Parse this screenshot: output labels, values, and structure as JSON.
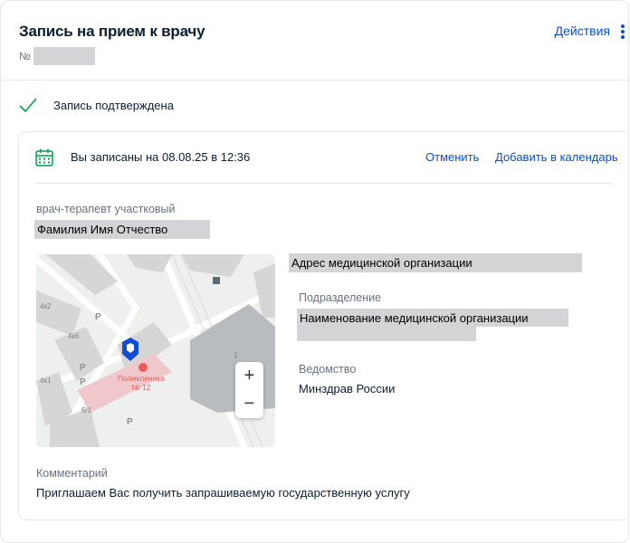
{
  "header": {
    "title": "Запись на прием к врачу",
    "number_prefix": "№",
    "actions_label": "Действия"
  },
  "status": {
    "text": "Запись подтверждена"
  },
  "appointment": {
    "date_text": "Вы записаны на 08.08.25 в 12:36",
    "cancel_label": "Отменить",
    "add_calendar_label": "Добавить в календарь"
  },
  "doctor": {
    "specialty": "врач-терапевт участковый",
    "name": "Фамилия Имя Отчество"
  },
  "organization": {
    "address": "Адрес медицинской организации",
    "division_label": "Подразделение",
    "division_value": "Наименование медицинской организации",
    "department_label": "Ведомство",
    "department_value": "Минздрав России"
  },
  "map": {
    "poi_name": "Поликлиника",
    "poi_number": "№ 12",
    "labels": [
      "4к2",
      "4к6",
      "4к1",
      "6/1",
      "1"
    ],
    "parking": "P",
    "zoom_in": "+",
    "zoom_out": "−"
  },
  "comment": {
    "label": "Комментарий",
    "text": "Приглашаем Вас получить запрашиваемую государственную услугу"
  },
  "colors": {
    "accent": "#0d4cd3",
    "success": "#00a050",
    "mask": "#d4d4d6",
    "poi": "#e85c5c"
  }
}
